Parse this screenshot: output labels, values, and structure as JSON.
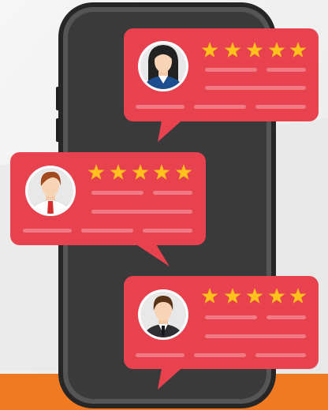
{
  "scene": {
    "background_color": "#f1f1f1",
    "floor_color": "#f07a22",
    "phone_frame_color": "#2e2e2e",
    "phone_screen_color": "#3d3d3d",
    "bubble_color": "#e8424f",
    "bubble_line_color": "#f07a83",
    "star_color": "#ffc21a"
  },
  "reviews": [
    {
      "avatar": "woman-avatar",
      "rating": 5,
      "shirt_color": "#1d4e8f"
    },
    {
      "avatar": "man-avatar-red-tie",
      "rating": 5,
      "shirt_color": "#ffffff"
    },
    {
      "avatar": "man-avatar-suit",
      "rating": 5,
      "shirt_color": "#2e2e33"
    }
  ]
}
